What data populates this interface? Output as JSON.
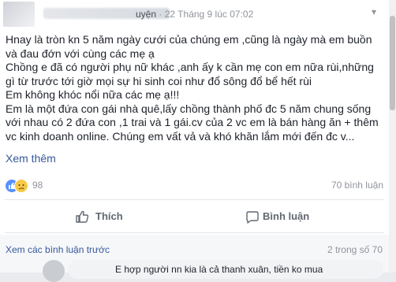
{
  "post": {
    "author_suffix": "uyện",
    "timestamp": "22 Tháng 9 lúc 07:02",
    "body_lines": [
      "Hnay là tròn kn 5 năm ngày cưới của chúng em ,cũng là ngày mà em buồn",
      "và đau đớn với cùng các mẹ ạ",
      "Chồng e đã có người phụ nữ khác ,anh ấy k cần mẹ con em nữa rùi,những",
      "gì từ trước tới giờ mọi sự hi sinh coi như đổ sông đổ bể hết rùi",
      "Em không khóc nổi nữa các mẹ ạ!!!",
      "Em là một đứa con gái nhà quê,lấy chồng thành phố đc 5 năm chung sống",
      "với nhau có 2 đứa con ,1 trai và 1 gái.cv của 2 vc em là bán hàng ăn + thêm",
      "vc kinh doanh online. Chúng em vất vả và khó khăn lắm mới đến đc v..."
    ],
    "see_more": "Xem thêm",
    "reaction_count": "98",
    "comment_count": "70 bình luận"
  },
  "actions": {
    "like_label": "Thích",
    "comment_label": "Bình luận"
  },
  "comments": {
    "prev_label": "Xem các bình luận trước",
    "pager": "2 trong số 70",
    "first_comment_snippet": "E hợp người nn kia là cả thanh xuân, tiền ko mua"
  },
  "colors": {
    "link": "#365899",
    "meta": "#90949c",
    "like_blue": "#5890ff",
    "sad_yellow": "#f7c948"
  },
  "icons": {
    "like_reaction": "like-icon",
    "sad_reaction": "sad-icon",
    "like_action": "thumbs-up-icon",
    "comment_action": "speech-bubble-icon",
    "menu": "chevron-down-icon"
  }
}
